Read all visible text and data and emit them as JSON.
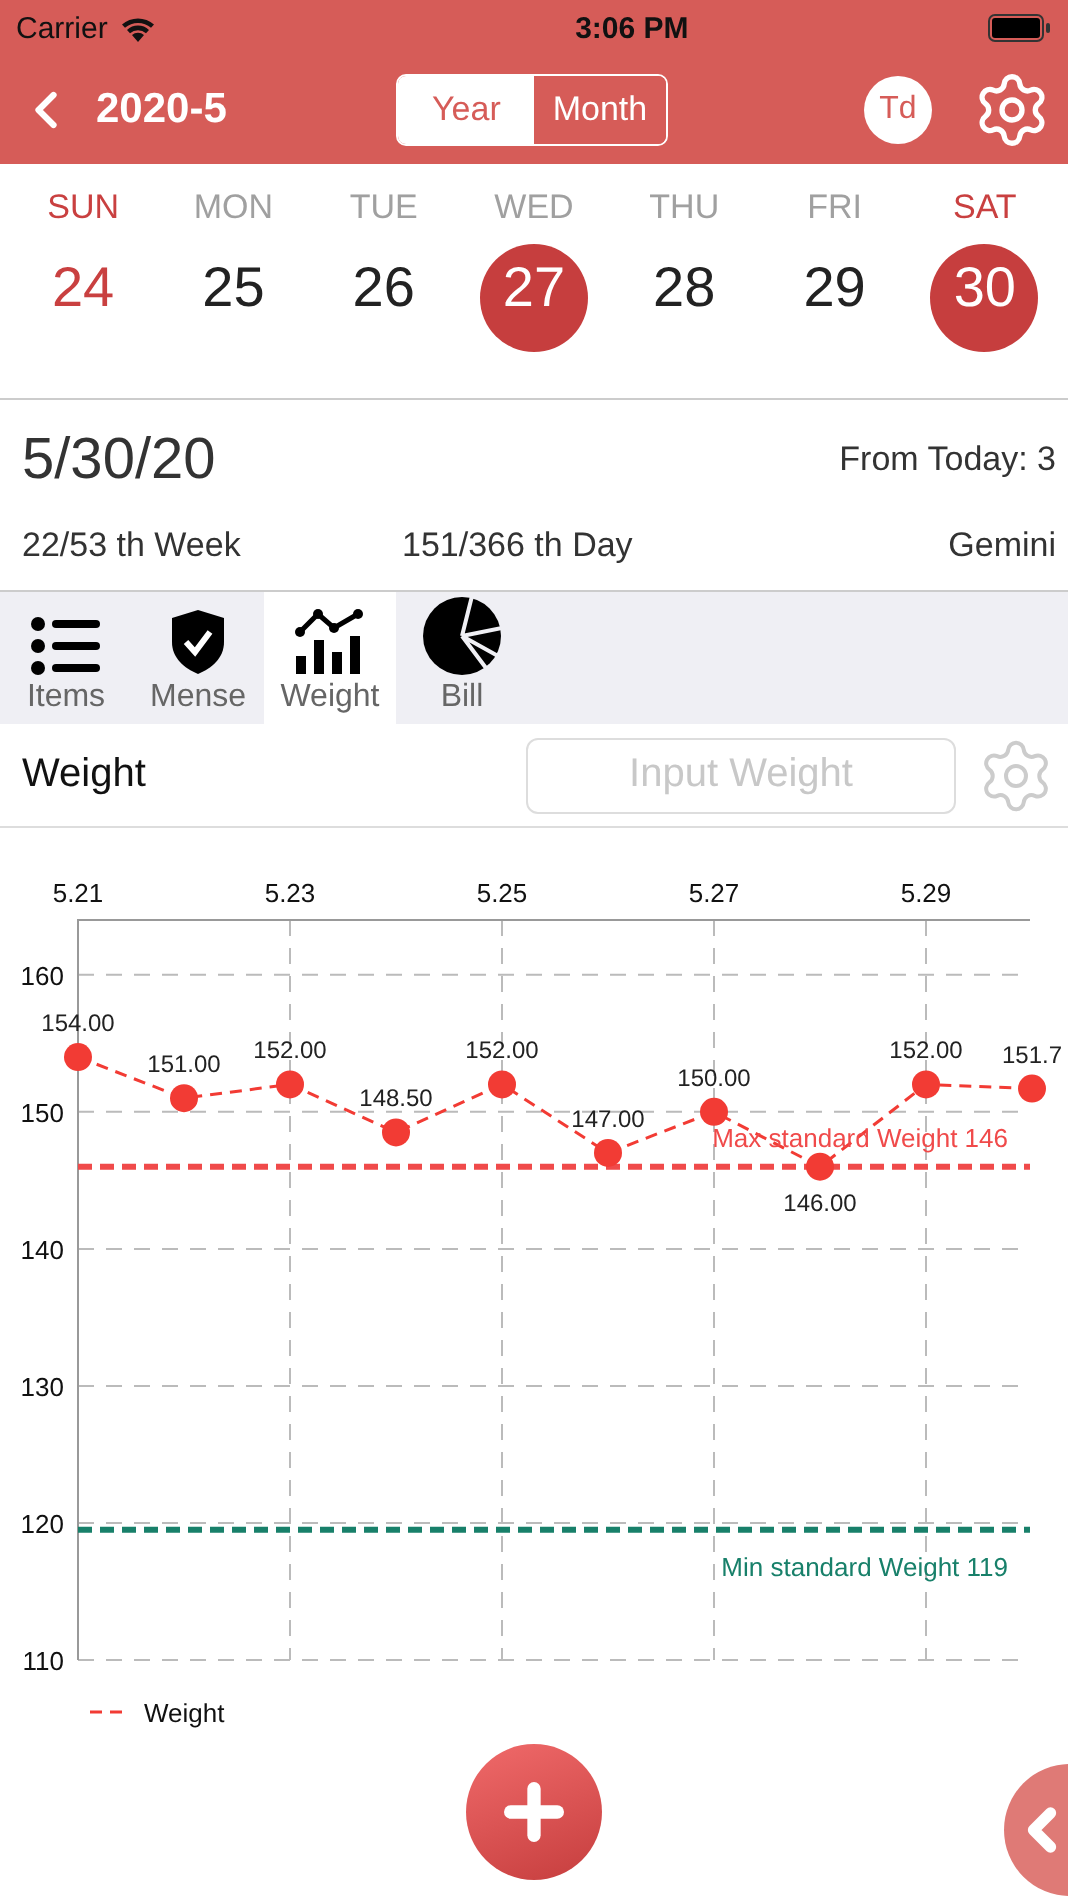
{
  "status_bar": {
    "carrier": "Carrier",
    "time": "3:06 PM"
  },
  "nav": {
    "title": "2020-5",
    "segments": [
      {
        "label": "Year",
        "selected": false
      },
      {
        "label": "Month",
        "selected": true
      }
    ],
    "today_button": "Td"
  },
  "week": [
    {
      "weekday": "SUN",
      "day": "24",
      "weekend": true,
      "selected": false
    },
    {
      "weekday": "MON",
      "day": "25",
      "weekend": false,
      "selected": false
    },
    {
      "weekday": "TUE",
      "day": "26",
      "weekend": false,
      "selected": false
    },
    {
      "weekday": "WED",
      "day": "27",
      "weekend": false,
      "selected": true
    },
    {
      "weekday": "THU",
      "day": "28",
      "weekend": false,
      "selected": false
    },
    {
      "weekday": "FRI",
      "day": "29",
      "weekend": false,
      "selected": false
    },
    {
      "weekday": "SAT",
      "day": "30",
      "weekend": true,
      "selected": true
    }
  ],
  "date_info": {
    "date": "5/30/20",
    "from_today": "From Today: 3",
    "week": "22/53 th Week",
    "day": "151/366 th Day",
    "sign": "Gemini"
  },
  "tabs": [
    {
      "label": "Items",
      "kind": "list",
      "selected": false
    },
    {
      "label": "Mense",
      "kind": "shield",
      "selected": false
    },
    {
      "label": "Weight",
      "kind": "chart",
      "selected": true
    },
    {
      "label": "Bill",
      "kind": "pie",
      "selected": false
    }
  ],
  "weight_panel": {
    "title": "Weight",
    "input": {
      "placeholder": "Input Weight"
    },
    "chart_data": {
      "type": "line",
      "x": [
        5.21,
        5.22,
        5.23,
        5.24,
        5.25,
        5.26,
        5.27,
        5.28,
        5.29,
        5.3
      ],
      "series": [
        {
          "name": "Weight",
          "color": "#f23b34",
          "line_style": "dashed",
          "marker": "circle",
          "values": [
            154,
            151,
            152,
            148.5,
            152,
            147,
            150,
            146,
            152,
            151.7
          ]
        }
      ],
      "grid": true,
      "xlim": [
        5.21,
        5.3
      ],
      "value_labels": [
        "154.00",
        "151.00",
        "152.00",
        "148.50",
        "152.00",
        "147.00",
        "150.00",
        "146.00",
        "152.00",
        "151.7"
      ],
      "ylim": [
        110,
        164
      ],
      "yticks": [
        110,
        120,
        130,
        140,
        150,
        160
      ],
      "xticks": [
        5.21,
        5.23,
        5.25,
        5.27,
        5.29
      ],
      "ref_lines": [
        {
          "axis": "y",
          "value": 146,
          "label": "Max standard Weight 146",
          "color": "#f04a4a"
        },
        {
          "axis": "y",
          "value": 119.5,
          "label": "Min standard Weight 119",
          "color": "#18806a"
        }
      ]
    }
  }
}
